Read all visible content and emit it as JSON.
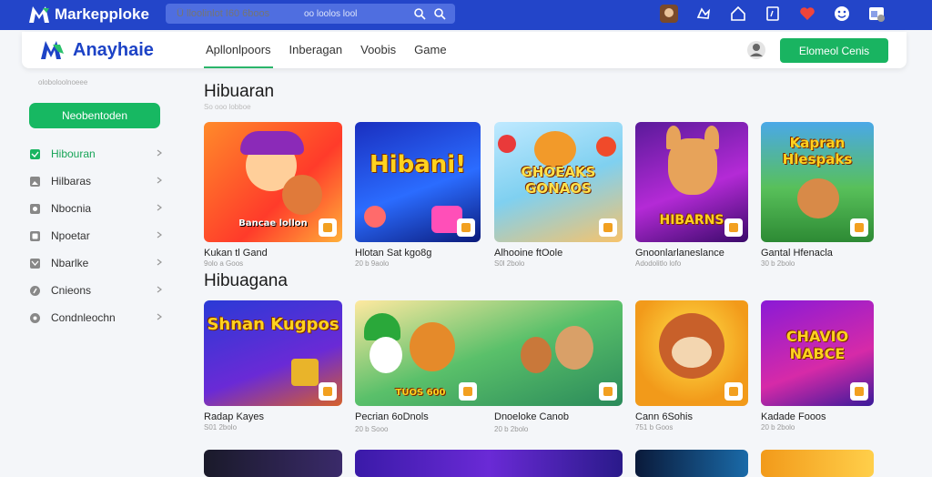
{
  "topbar": {
    "brand": "Markepploke",
    "search_placeholder": "Ũ lloolinlot I60 6boos",
    "search_chip": "oo loolos lool",
    "icons": [
      "avatar-icon",
      "shape-icon",
      "home-icon",
      "tag-icon",
      "heart-icon",
      "smile-icon",
      "browser-icon"
    ]
  },
  "header": {
    "brand": "Anayhaie",
    "tabs": [
      "Apllonlpoors",
      "Inberagan",
      "Voobis",
      "Game"
    ],
    "active_tab": 0,
    "cta": "Elomeol Cenis"
  },
  "sidebar": {
    "caption": "oloboloolnoeee",
    "primary_button": "Neobentoden",
    "items": [
      {
        "label": "Hibouran",
        "icon": "chat-icon",
        "active": true
      },
      {
        "label": "Hilbaras",
        "icon": "image-icon",
        "active": false
      },
      {
        "label": "Nbocnia",
        "icon": "message-icon",
        "active": false
      },
      {
        "label": "Npoetar",
        "icon": "screen-icon",
        "active": false
      },
      {
        "label": "Nbarlke",
        "icon": "mail-icon",
        "active": false
      },
      {
        "label": "Cnieons",
        "icon": "pin-icon",
        "active": false
      },
      {
        "label": "Condnleochn",
        "icon": "gear-icon",
        "active": false
      }
    ]
  },
  "sections": [
    {
      "title": "Hibuaran",
      "subtitle": "So ooo lobboe",
      "cards": [
        {
          "title": "Kukan tl Gand",
          "meta": "9olo a Goos",
          "art": "Bancae lollon"
        },
        {
          "title": "Hlotan Sat kgo8g",
          "meta": "20 b 9aolo",
          "art": "Hibani!"
        },
        {
          "title": "Alhooine ftOole",
          "meta": "S0l 2bolo",
          "art": "GHOEAKS GONAOS"
        },
        {
          "title": "Gnoonlarlaneslance",
          "meta": "Adodolitlo lofo",
          "art": "HIBARNS"
        },
        {
          "title": "Gantal Hfenacla",
          "meta": "30 b 2bolo",
          "art": "Kapran Hlespaks"
        }
      ]
    },
    {
      "title": "Hibuagana",
      "subtitle": "",
      "cards": [
        {
          "title": "Radap Kayes",
          "meta": "S01 2bolo",
          "art": "Shnan Kugpos"
        },
        {
          "title": "Pecrian 6oDnols",
          "meta": "20 b Sooo",
          "art": "TUOS 600"
        },
        {
          "title": "Dnoeloke Canob",
          "meta": "20 b 2bolo",
          "art": ""
        },
        {
          "title": "Cann 6Sohis",
          "meta": "751 b Goos",
          "art": ""
        },
        {
          "title": "Kadade Fooos",
          "meta": "20 b 2bolo",
          "art": "CHAVIO NABCE"
        }
      ]
    }
  ]
}
